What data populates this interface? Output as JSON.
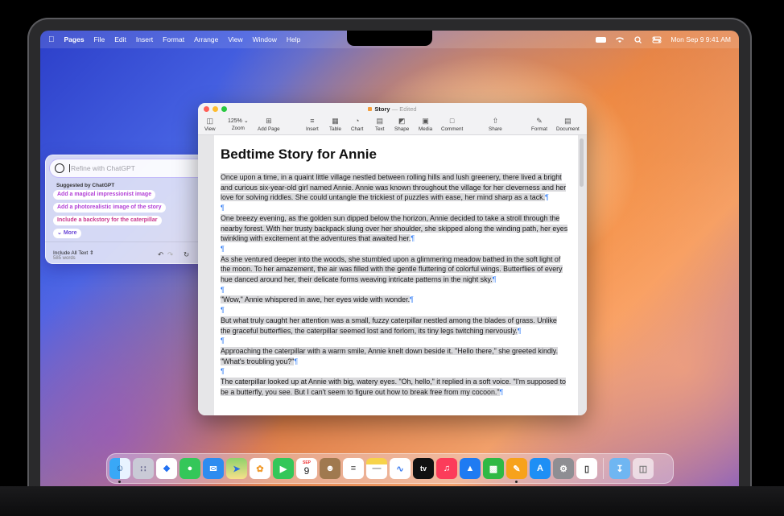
{
  "menubar": {
    "app": "Pages",
    "items": [
      "File",
      "Edit",
      "Insert",
      "Format",
      "Arrange",
      "View",
      "Window",
      "Help"
    ],
    "datetime": "Mon Sep 9  9:41 AM",
    "icons": [
      "apple-icon",
      "battery-icon",
      "wifi-icon",
      "search-icon",
      "control-center-icon"
    ]
  },
  "window": {
    "title": "Story",
    "status": "Edited",
    "zoom": "125%",
    "toolbar": {
      "view": "View",
      "zoom": "Zoom",
      "add_page": "Add Page",
      "insert": "Insert",
      "table": "Table",
      "chart": "Chart",
      "text": "Text",
      "shape": "Shape",
      "media": "Media",
      "comment": "Comment",
      "share": "Share",
      "format": "Format",
      "document": "Document"
    }
  },
  "document": {
    "title": "Bedtime Story for Annie",
    "paragraphs": [
      "Once upon a time, in a quaint little village nestled between rolling hills and lush greenery, there lived a bright and curious six-year-old girl named Annie. Annie was known throughout the village for her cleverness and her love for solving riddles. She could untangle the trickiest of puzzles with ease, her mind sharp as a tack.",
      "One breezy evening, as the golden sun dipped below the horizon, Annie decided to take a stroll through the nearby forest. With her trusty backpack slung over her shoulder, she skipped along the winding path, her eyes twinkling with excitement at the adventures that awaited her.",
      "As she ventured deeper into the woods, she stumbled upon a glimmering meadow bathed in the soft light of the moon. To her amazement, the air was filled with the gentle fluttering of colorful wings. Butterflies of every hue danced around her, their delicate forms weaving intricate patterns in the night sky.",
      "\"Wow,\" Annie whispered in awe, her eyes wide with wonder.",
      "But what truly caught her attention was a small, fuzzy caterpillar nestled among the blades of grass. Unlike the graceful butterflies, the caterpillar seemed lost and forlorn, its tiny legs twitching nervously.",
      "Approaching the caterpillar with a warm smile, Annie knelt down beside it. \"Hello there,\" she greeted kindly. \"What's troubling you?\"",
      "The caterpillar looked up at Annie with big, watery eyes. \"Oh, hello,\" it replied in a soft voice. \"I'm supposed to be a butterfly, you see. But I can't seem to figure out how to break free from my cocoon.\""
    ],
    "pilcrow": "¶"
  },
  "gpt_panel": {
    "placeholder": "Refine with ChatGPT",
    "suggested_label": "Suggested by ChatGPT",
    "suggestions": [
      "Add a magical impressionist image",
      "Add a photorealistic image of the story",
      "Include a backstory for the caterpillar"
    ],
    "more": "More",
    "scope": "Include All Text",
    "word_count": "585 words"
  },
  "dock": {
    "apps": [
      "Finder",
      "Launchpad",
      "Safari",
      "Messages",
      "Mail",
      "Maps",
      "Photos",
      "FaceTime",
      "Calendar",
      "Contacts",
      "Reminders",
      "Notes",
      "Freeform",
      "TV",
      "Music",
      "Keynote",
      "Numbers",
      "Pages",
      "App Store",
      "System Settings",
      "iPhone Mirroring",
      "Downloads",
      "Trash"
    ],
    "calendar_month": "SEP",
    "calendar_day": "9",
    "tv_label": "tv"
  }
}
